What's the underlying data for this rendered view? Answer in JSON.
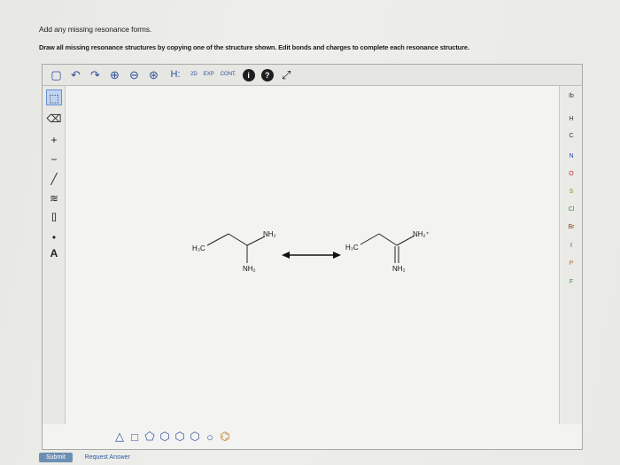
{
  "instructions": {
    "line1": "Add any missing resonance forms.",
    "line2": "Draw all missing resonance structures by copying one of the structure shown. Edit bonds and charges to complete each resonance structure."
  },
  "toolbar_top": {
    "items": [
      {
        "name": "new-doc-icon",
        "glyph": "▢"
      },
      {
        "name": "undo-icon",
        "glyph": "↶"
      },
      {
        "name": "redo-icon",
        "glyph": "↷"
      },
      {
        "name": "zoom-in-icon",
        "glyph": "⊕"
      },
      {
        "name": "zoom-out-icon",
        "glyph": "⊖"
      },
      {
        "name": "zoom-reset-icon",
        "glyph": "⊛"
      }
    ],
    "hydrogen_label": "H:",
    "tool_2d_label": "2D",
    "tool_exp_label": "EXP",
    "tool_cont_label": "CONT.",
    "info_label": "i",
    "help_label": "?",
    "expand_icon": "⤢"
  },
  "toolbar_left": {
    "items": [
      {
        "name": "select-tool-icon",
        "glyph": "⬚"
      },
      {
        "name": "erase-tool-icon",
        "glyph": "⌫"
      },
      {
        "name": "plus-charge-icon",
        "glyph": "+"
      },
      {
        "name": "minus-charge-icon",
        "glyph": "−"
      },
      {
        "name": "single-bond-icon",
        "glyph": "╱"
      },
      {
        "name": "multi-bond-icon",
        "glyph": "≋"
      },
      {
        "name": "bracket-tool-icon",
        "glyph": "[]"
      },
      {
        "name": "radical-icon",
        "glyph": "•"
      },
      {
        "name": "atom-properties-icon",
        "glyph": "A"
      }
    ]
  },
  "periodic_right": {
    "header": "Ib",
    "elements": [
      "H",
      "C",
      "N",
      "O",
      "S",
      "Cl",
      "Br",
      "I",
      "P",
      "F"
    ]
  },
  "toolbar_bottom": {
    "shapes": [
      "△",
      "□",
      "⬠",
      "⬡",
      "⬡",
      "⬡",
      "○",
      "⌬"
    ]
  },
  "molecules": {
    "left": {
      "methyl": "H₃C",
      "top_group": "NH₂",
      "bottom_group": "NH₂"
    },
    "right": {
      "methyl": "H₃C",
      "top_group": "NH₂⁺",
      "bottom_group": "NH₂"
    }
  },
  "footer": {
    "submit_label": "Submit",
    "request_label": "Request Answer"
  }
}
